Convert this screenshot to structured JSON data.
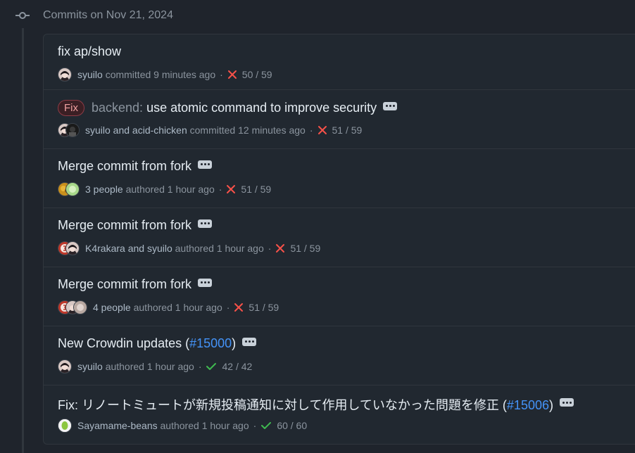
{
  "day": {
    "title": "Commits on Nov 21, 2024"
  },
  "commits": [
    {
      "title": "fix ap/show",
      "authors": "syuilo",
      "action": "committed",
      "time": "9 minutes ago",
      "status": "fail",
      "checks": "50 / 59"
    },
    {
      "label": "Fix",
      "scope": "backend:",
      "title": "use atomic command to improve security",
      "authors": "syuilo and acid-chicken",
      "action": "committed",
      "time": "12 minutes ago",
      "status": "fail",
      "checks": "51 / 59"
    },
    {
      "title": "Merge commit from fork",
      "authors": "3 people",
      "action": "authored",
      "time": "1 hour ago",
      "status": "fail",
      "checks": "51 / 59"
    },
    {
      "title": "Merge commit from fork",
      "authors": "K4rakara and syuilo",
      "action": "authored",
      "time": "1 hour ago",
      "status": "fail",
      "checks": "51 / 59"
    },
    {
      "title": "Merge commit from fork",
      "authors": "4 people",
      "action": "authored",
      "time": "1 hour ago",
      "status": "fail",
      "checks": "51 / 59"
    },
    {
      "title": "New Crowdin updates (",
      "link": "#15000",
      "title_end": ")",
      "authors": "syuilo",
      "action": "authored",
      "time": "1 hour ago",
      "status": "pass",
      "checks": "42 / 42"
    },
    {
      "title": "Fix: リノートミュートが新規投稿通知に対して作用していなかった問題を修正 (",
      "link": "#15006",
      "title_end": ")",
      "authors": "Sayamame-beans",
      "action": "authored",
      "time": "1 hour ago",
      "status": "pass",
      "checks": "60 / 60"
    }
  ],
  "colors": {
    "fail": "#f85149",
    "pass": "#3fb950",
    "link": "#4493f8"
  },
  "icons": {
    "node": "git-commit-icon",
    "fail": "x-icon",
    "pass": "check-icon",
    "more": "kebab-horizontal-icon"
  }
}
